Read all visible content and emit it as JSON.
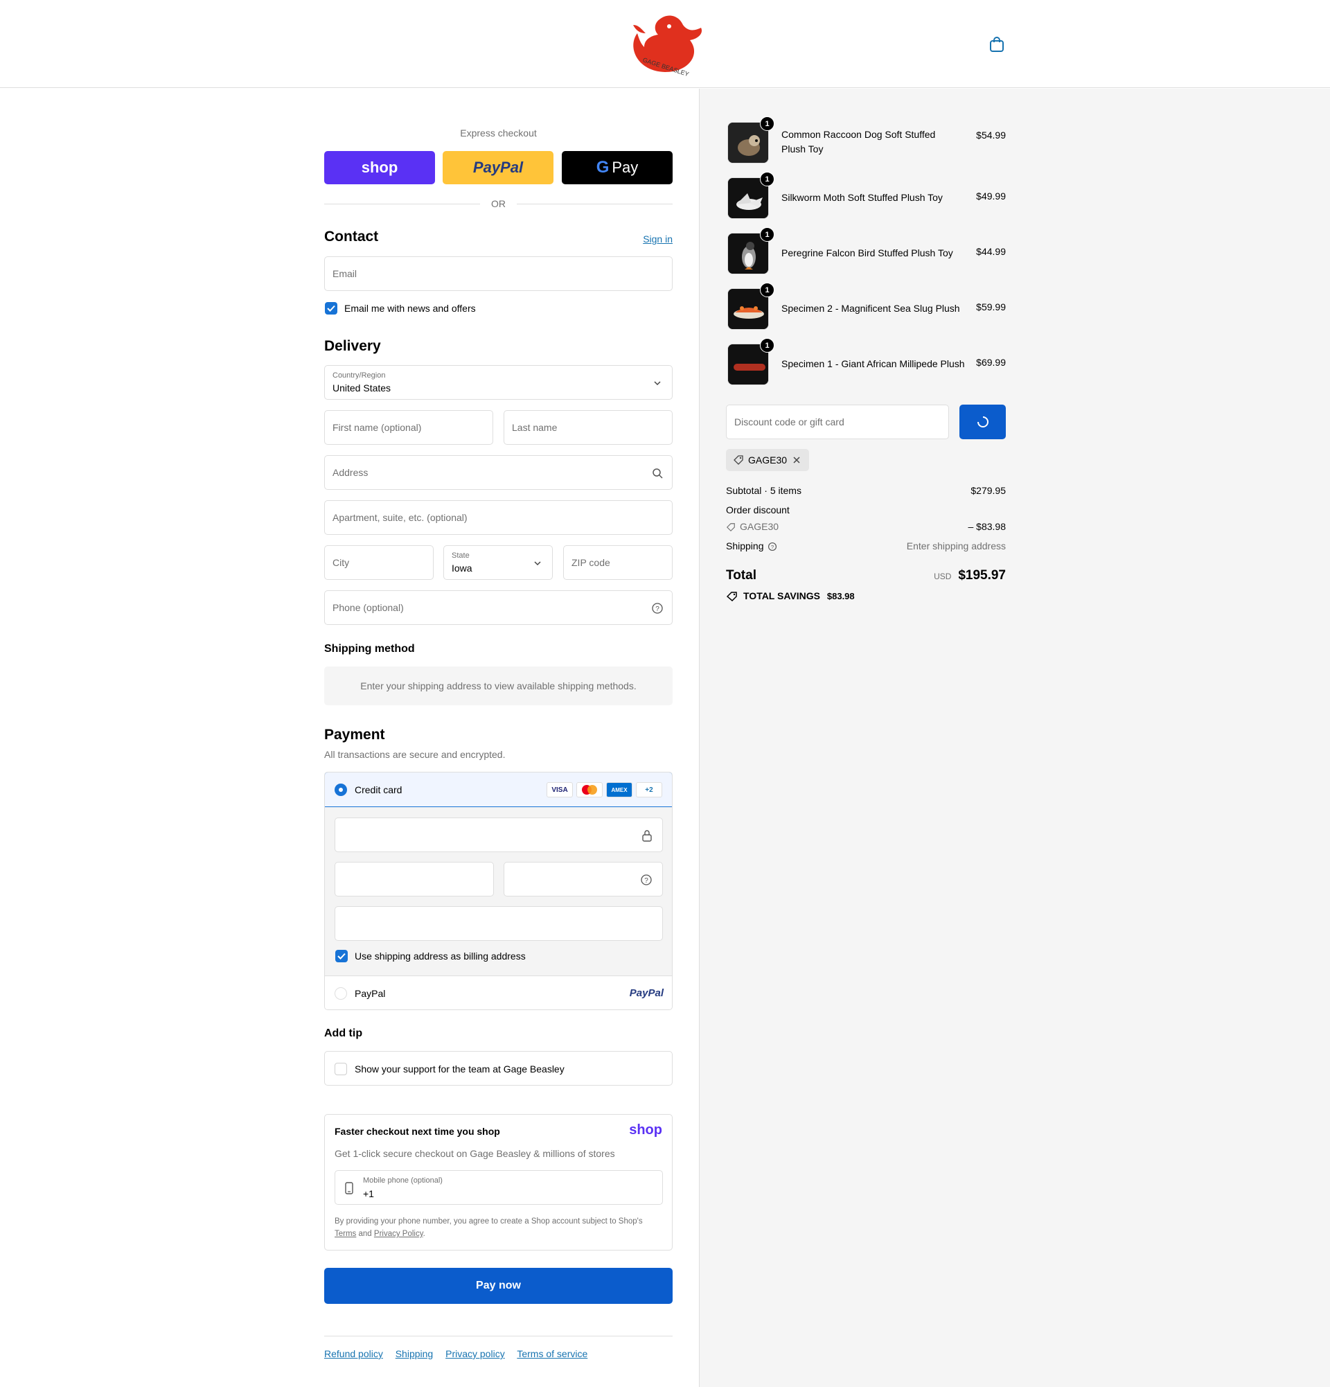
{
  "header": {
    "brand_text": "GAGE BEASLEY"
  },
  "express": {
    "label": "Express checkout",
    "shop": "shop",
    "paypal": "PayPal",
    "gpay": "Pay",
    "or": "OR"
  },
  "contact": {
    "title": "Contact",
    "sign_in": "Sign in",
    "email_placeholder": "Email",
    "news_label": "Email me with news and offers",
    "news_checked": true
  },
  "delivery": {
    "title": "Delivery",
    "country_label": "Country/Region",
    "country_value": "United States",
    "first_name": "First name (optional)",
    "last_name": "Last name",
    "address": "Address",
    "apartment": "Apartment, suite, etc. (optional)",
    "city": "City",
    "state_label": "State",
    "state_value": "Iowa",
    "zip": "ZIP code",
    "phone": "Phone (optional)"
  },
  "shipping_method": {
    "title": "Shipping method",
    "note": "Enter your shipping address to view available shipping methods."
  },
  "payment": {
    "title": "Payment",
    "subtitle": "All transactions are secure and encrypted.",
    "credit_card": "Credit card",
    "card_logos": [
      "VISA",
      "",
      "AMEX",
      "+2"
    ],
    "billing_label": "Use shipping address as billing address",
    "paypal_label": "PayPal",
    "paypal_logo": "PayPal"
  },
  "tip": {
    "title": "Add tip",
    "label": "Show your support for the team at Gage Beasley"
  },
  "shop_pay": {
    "title": "Faster checkout next time you shop",
    "logo": "shop",
    "subtitle": "Get 1-click secure checkout on Gage Beasley & millions of stores",
    "phone_label": "Mobile phone (optional)",
    "phone_value": "+1",
    "legal_1": "By providing your phone number, you agree to create a Shop account subject to Shop's",
    "terms": "Terms",
    "and": "and",
    "privacy": "Privacy Policy",
    "period": "."
  },
  "pay_now": "Pay now",
  "footer": [
    "Refund policy",
    "Shipping",
    "Privacy policy",
    "Terms of service"
  ],
  "items": [
    {
      "name": "Common Raccoon Dog Soft Stuffed Plush Toy",
      "price": "$54.99",
      "qty": "1"
    },
    {
      "name": "Silkworm Moth Soft Stuffed Plush Toy",
      "price": "$49.99",
      "qty": "1"
    },
    {
      "name": "Peregrine Falcon Bird Stuffed Plush Toy",
      "price": "$44.99",
      "qty": "1"
    },
    {
      "name": "Specimen 2 - Magnificent Sea Slug Plush",
      "price": "$59.99",
      "qty": "1"
    },
    {
      "name": "Specimen 1 - Giant African Millipede Plush",
      "price": "$69.99",
      "qty": "1"
    }
  ],
  "discount": {
    "placeholder": "Discount code or gift card",
    "applied_code": "GAGE30"
  },
  "totals": {
    "subtotal_label": "Subtotal · 5 items",
    "subtotal": "$279.95",
    "order_discount_label": "Order discount",
    "discount_code": "GAGE30",
    "discount_amount": "– $83.98",
    "shipping_label": "Shipping",
    "shipping_value": "Enter shipping address",
    "total_label": "Total",
    "currency": "USD",
    "total": "$195.97",
    "savings_label": "TOTAL SAVINGS",
    "savings": "$83.98"
  },
  "colors": {
    "accent": "#1773d6",
    "pay_button": "#0b5ccc",
    "shop": "#5a31f4",
    "paypal": "#ffc439",
    "brand_red": "#e0301e"
  }
}
